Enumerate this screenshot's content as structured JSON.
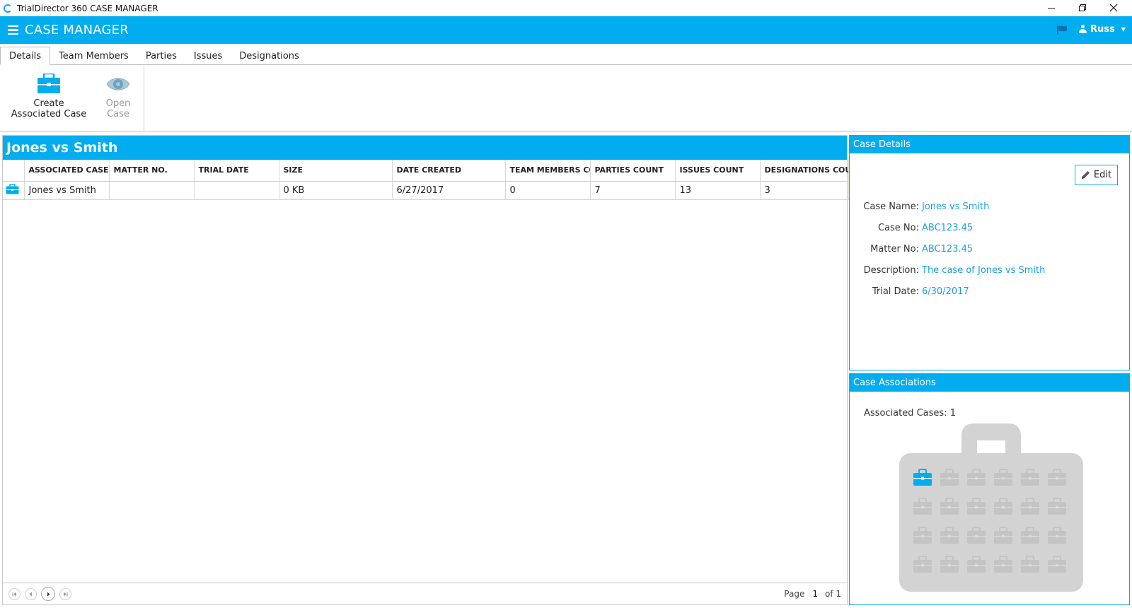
{
  "window": {
    "title": "TrialDirector 360 CASE MANAGER",
    "controls": [
      "minimize",
      "restore",
      "close"
    ]
  },
  "header": {
    "title": "CASE MANAGER",
    "user": "Russ"
  },
  "tabs": [
    {
      "label": "Details",
      "active": true
    },
    {
      "label": "Team Members",
      "active": false
    },
    {
      "label": "Parties",
      "active": false
    },
    {
      "label": "Issues",
      "active": false
    },
    {
      "label": "Designations",
      "active": false
    }
  ],
  "ribbon": {
    "create_label_1": "Create",
    "create_label_2": "Associated Case",
    "open_label_1": "Open",
    "open_label_2": "Case"
  },
  "case_panel": {
    "title": "Jones vs Smith",
    "columns": [
      "ASSOCIATED CASE",
      "MATTER NO.",
      "TRIAL DATE",
      "SIZE",
      "DATE CREATED",
      "TEAM MEMBERS COU",
      "PARTIES COUNT",
      "ISSUES COUNT",
      "DESIGNATIONS COUN"
    ],
    "rows": [
      [
        "Jones vs Smith",
        "",
        "",
        "0 KB",
        "6/27/2017",
        "0",
        "7",
        "13",
        "3"
      ]
    ],
    "pager": {
      "page_label": "Page",
      "page": "1",
      "of_label": "of 1"
    }
  },
  "case_details": {
    "header": "Case Details",
    "edit_label": "Edit",
    "fields": [
      {
        "label": "Case Name:",
        "value": "Jones vs Smith"
      },
      {
        "label": "Case No:",
        "value": "ABC123.45"
      },
      {
        "label": "Matter No:",
        "value": "ABC123.45"
      },
      {
        "label": "Description:",
        "value": "The case of Jones vs Smith"
      },
      {
        "label": "Trial Date:",
        "value": "6/30/2017"
      }
    ]
  },
  "case_associations": {
    "header": "Case Associations",
    "count_text": "Associated Cases: 1"
  },
  "colors": {
    "accent": "#01adef",
    "link": "#1a9fe0",
    "inactive_icon": "#cccccc",
    "bag_gray": "#d3d3d3"
  }
}
